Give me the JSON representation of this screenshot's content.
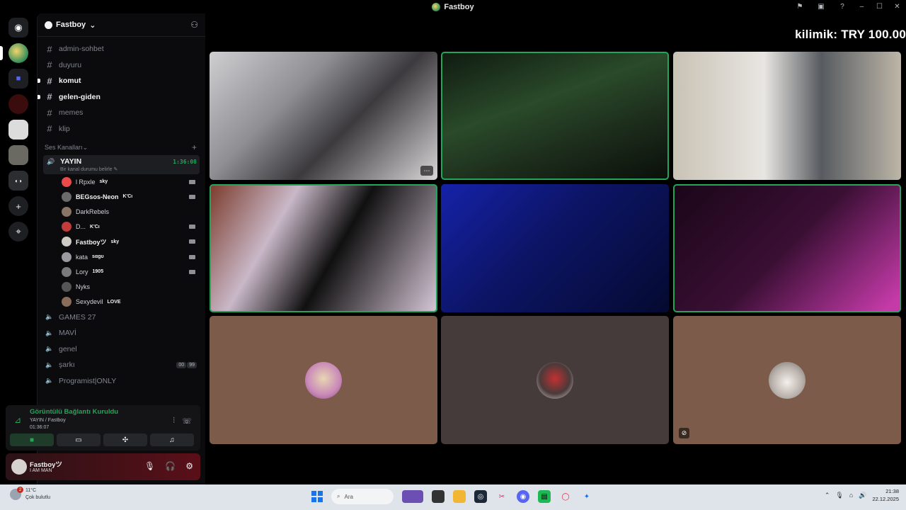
{
  "window": {
    "title": "Fastboy",
    "controls": [
      "⚑",
      "▣",
      "?",
      "–",
      "☐",
      "✕"
    ]
  },
  "server": {
    "name": "Fastboy",
    "text_channels": [
      {
        "name": "admin-sohbet",
        "unread": false
      },
      {
        "name": "duyuru",
        "unread": false
      },
      {
        "name": "komut",
        "unread": true
      },
      {
        "name": "gelen-giden",
        "unread": true
      },
      {
        "name": "memes",
        "unread": false
      },
      {
        "name": "klip",
        "unread": false
      }
    ],
    "voice_category": "Ses Kanalları",
    "active_voice": {
      "name": "YAYIN",
      "time": "1:36:08",
      "status_hint": "Bir kanal durumu belirle"
    },
    "members": [
      {
        "name": "l Rpxle",
        "tag": "sky",
        "bold": false,
        "color": "#e84a4a",
        "cam": true
      },
      {
        "name": "BEGsos-Neon",
        "tag": "K'Cı",
        "bold": true,
        "color": "#6b6b6b",
        "cam": true
      },
      {
        "name": "DarkRebels",
        "tag": "",
        "bold": false,
        "color": "#8a7566",
        "cam": false
      },
      {
        "name": "D...",
        "tag": "K'Cı",
        "bold": false,
        "color": "#c33c3c",
        "cam": true
      },
      {
        "name": "Fastboyツ",
        "tag": "sky",
        "bold": true,
        "color": "#cfcac6",
        "cam": true
      },
      {
        "name": "kata",
        "tag": "ѕαgυ",
        "bold": false,
        "color": "#9a9aa0",
        "cam": true
      },
      {
        "name": "Lory",
        "tag": "1905",
        "bold": false,
        "color": "#7a7a7a",
        "cam": true
      },
      {
        "name": "Nyks",
        "tag": "",
        "bold": false,
        "color": "#555",
        "cam": false
      },
      {
        "name": "Sexydevil",
        "tag": "LOVE",
        "bold": false,
        "color": "#8a6c5b",
        "cam": false
      }
    ],
    "voice_channels": [
      {
        "name": "GAMES 27",
        "counts": []
      },
      {
        "name": "MAVİ",
        "counts": []
      },
      {
        "name": "genel",
        "counts": []
      },
      {
        "name": "şarkı",
        "counts": [
          "00",
          "99"
        ]
      },
      {
        "name": "Programist|ONLY",
        "counts": []
      }
    ]
  },
  "connection": {
    "status": "Görüntülü Bağlantı Kuruldu",
    "route": "YAYIN / Fastboy",
    "elapsed": "01:36:07",
    "buttons": [
      "camera",
      "screen-share",
      "activities",
      "soundboard"
    ]
  },
  "user": {
    "name": "Fastboyツ",
    "status": "I AM MAN"
  },
  "stage": {
    "donation": "kilimik: TRY 100.00",
    "tiles": [
      {
        "kind": "video",
        "speaking": false,
        "bg": "linear-gradient(135deg,#cfcfd1 0%,#8f8f94 35%,#3c3a3d 60%,#d8d6d7 100%)",
        "more": true
      },
      {
        "kind": "video",
        "speaking": true,
        "bg": "linear-gradient(160deg,#0f1a10 0%,#2a4a2a 40%,#1b2a1a 70%,#0a0f0a 100%)",
        "more": false
      },
      {
        "kind": "video",
        "speaking": false,
        "bg": "linear-gradient(90deg,#c9c2b5 0%,#e8e6e2 40%,#575b60 65%,#bdb6a8 100%)",
        "more": false
      },
      {
        "kind": "video",
        "speaking": true,
        "bg": "linear-gradient(120deg,#7a3a2a 0%,#c9b8c8 30%,#101010 55%,#d8c8d8 100%)",
        "more": false
      },
      {
        "kind": "video",
        "speaking": false,
        "bg": "linear-gradient(135deg,#1522a8 0%,#0c1464 45%,#050a30 100%)",
        "more": false
      },
      {
        "kind": "video",
        "speaking": true,
        "bg": "linear-gradient(135deg,#1a0618 0%,#3a0f34 50%,#c43aa8 95%)",
        "more": false
      },
      {
        "kind": "avatar",
        "speaking": false,
        "bg": "#7c5b4b",
        "avatar_bg": "radial-gradient(circle at 50% 45%,#e8d6b2 0%,#c989b8 60%,#8a4a78 100%)",
        "muted": false
      },
      {
        "kind": "avatar",
        "speaking": false,
        "bg": "#453b3b",
        "avatar_bg": "radial-gradient(circle at 50% 45%,#c33030 0%,#4a3a3a 55%,#d8d4d0 100%)",
        "muted": false
      },
      {
        "kind": "avatar",
        "speaking": false,
        "bg": "#7c5b4b",
        "avatar_bg": "radial-gradient(circle at 50% 55%,#f4f0ec 0%,#b9b1ab 55%,#6f6a66 100%)",
        "muted": true
      }
    ]
  },
  "taskbar": {
    "weather_temp": "11°C",
    "weather_desc": "Çok bulutlu",
    "notification_count": "2",
    "search_placeholder": "Ara",
    "time": "21:38",
    "date": "22.12.2025"
  }
}
